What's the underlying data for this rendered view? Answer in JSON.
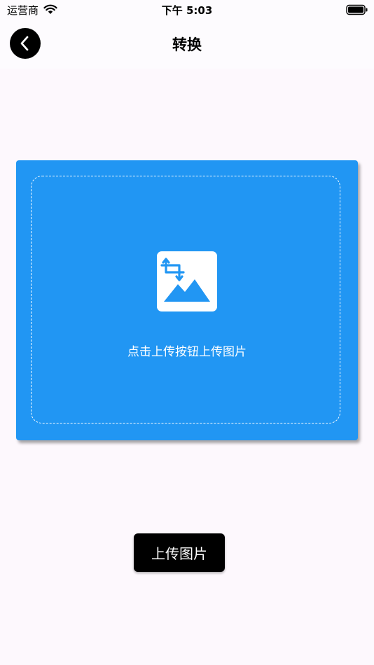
{
  "status_bar": {
    "carrier": "运营商",
    "time": "下午 5:03"
  },
  "nav": {
    "title": "转换",
    "back_icon": "chevron-left-icon"
  },
  "upload_area": {
    "hint": "点击上传按钮上传图片",
    "icon": "image-crop-icon"
  },
  "upload_button": {
    "label": "上传图片"
  },
  "colors": {
    "accent": "#2196f3",
    "background": "#fdf8fd",
    "button": "#000000"
  }
}
